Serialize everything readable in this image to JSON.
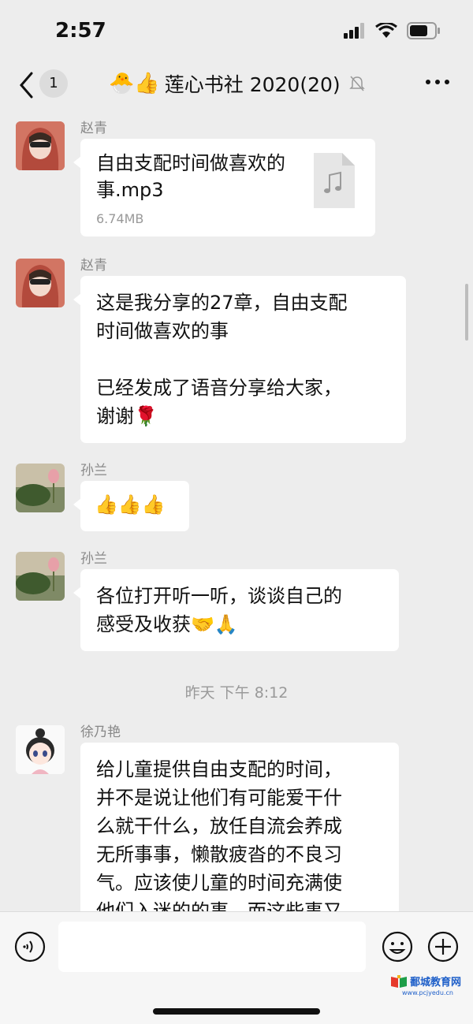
{
  "status_bar": {
    "time": "2:57"
  },
  "nav": {
    "unread_count": "1",
    "title_emoji": "🐣👍",
    "title": "莲心书社 2020(20)"
  },
  "messages": [
    {
      "sender": "赵青",
      "type": "file",
      "file_name": "自由支配时间做喜欢的事.mp3",
      "file_size": "6.74MB"
    },
    {
      "sender": "赵青",
      "type": "text",
      "lines": [
        "这是我分享的27章，自由支配",
        "时间做喜欢的事",
        "",
        "已经发成了语音分享给大家，",
        "谢谢🌹"
      ]
    },
    {
      "sender": "孙兰",
      "type": "text",
      "lines": [
        "👍👍👍"
      ]
    },
    {
      "sender": "孙兰",
      "type": "text",
      "lines": [
        "各位打开听一听，谈谈自己的",
        "感受及收获🤝🙏"
      ]
    },
    {
      "sender": "徐乃艳",
      "type": "text",
      "lines": [
        "给儿童提供自由支配的时间，",
        "并不是说让他们有可能爱干什",
        "么就干什么，放任自流会养成",
        "无所事事，懒散疲沓的不良习",
        "气。应该使儿童的时间充满使",
        "他们入迷的的事，而这些事又"
      ]
    }
  ],
  "timestamp": "昨天 下午 8:12",
  "watermark": {
    "text": "鄱城教育网",
    "url": "www.pcjyedu.cn"
  },
  "colors": {
    "background": "#ededed",
    "bubble": "#ffffff",
    "sender_text": "#888888"
  }
}
